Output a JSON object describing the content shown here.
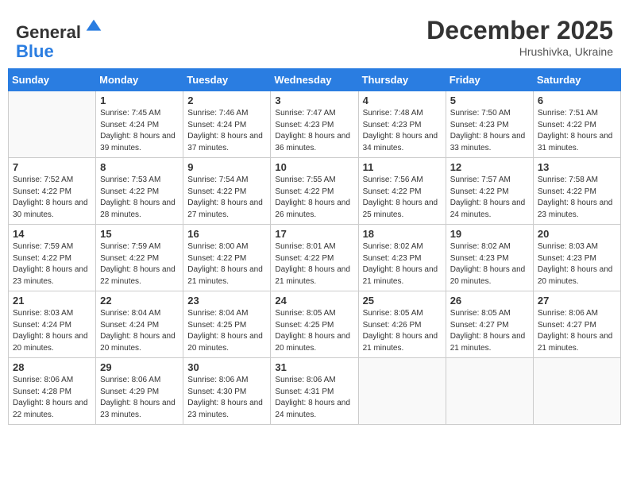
{
  "header": {
    "logo_line1": "General",
    "logo_line2": "Blue",
    "month": "December 2025",
    "location": "Hrushivka, Ukraine"
  },
  "weekdays": [
    "Sunday",
    "Monday",
    "Tuesday",
    "Wednesday",
    "Thursday",
    "Friday",
    "Saturday"
  ],
  "weeks": [
    [
      {
        "day": "",
        "sunrise": "",
        "sunset": "",
        "daylight": ""
      },
      {
        "day": "1",
        "sunrise": "Sunrise: 7:45 AM",
        "sunset": "Sunset: 4:24 PM",
        "daylight": "Daylight: 8 hours and 39 minutes."
      },
      {
        "day": "2",
        "sunrise": "Sunrise: 7:46 AM",
        "sunset": "Sunset: 4:24 PM",
        "daylight": "Daylight: 8 hours and 37 minutes."
      },
      {
        "day": "3",
        "sunrise": "Sunrise: 7:47 AM",
        "sunset": "Sunset: 4:23 PM",
        "daylight": "Daylight: 8 hours and 36 minutes."
      },
      {
        "day": "4",
        "sunrise": "Sunrise: 7:48 AM",
        "sunset": "Sunset: 4:23 PM",
        "daylight": "Daylight: 8 hours and 34 minutes."
      },
      {
        "day": "5",
        "sunrise": "Sunrise: 7:50 AM",
        "sunset": "Sunset: 4:23 PM",
        "daylight": "Daylight: 8 hours and 33 minutes."
      },
      {
        "day": "6",
        "sunrise": "Sunrise: 7:51 AM",
        "sunset": "Sunset: 4:22 PM",
        "daylight": "Daylight: 8 hours and 31 minutes."
      }
    ],
    [
      {
        "day": "7",
        "sunrise": "Sunrise: 7:52 AM",
        "sunset": "Sunset: 4:22 PM",
        "daylight": "Daylight: 8 hours and 30 minutes."
      },
      {
        "day": "8",
        "sunrise": "Sunrise: 7:53 AM",
        "sunset": "Sunset: 4:22 PM",
        "daylight": "Daylight: 8 hours and 28 minutes."
      },
      {
        "day": "9",
        "sunrise": "Sunrise: 7:54 AM",
        "sunset": "Sunset: 4:22 PM",
        "daylight": "Daylight: 8 hours and 27 minutes."
      },
      {
        "day": "10",
        "sunrise": "Sunrise: 7:55 AM",
        "sunset": "Sunset: 4:22 PM",
        "daylight": "Daylight: 8 hours and 26 minutes."
      },
      {
        "day": "11",
        "sunrise": "Sunrise: 7:56 AM",
        "sunset": "Sunset: 4:22 PM",
        "daylight": "Daylight: 8 hours and 25 minutes."
      },
      {
        "day": "12",
        "sunrise": "Sunrise: 7:57 AM",
        "sunset": "Sunset: 4:22 PM",
        "daylight": "Daylight: 8 hours and 24 minutes."
      },
      {
        "day": "13",
        "sunrise": "Sunrise: 7:58 AM",
        "sunset": "Sunset: 4:22 PM",
        "daylight": "Daylight: 8 hours and 23 minutes."
      }
    ],
    [
      {
        "day": "14",
        "sunrise": "Sunrise: 7:59 AM",
        "sunset": "Sunset: 4:22 PM",
        "daylight": "Daylight: 8 hours and 23 minutes."
      },
      {
        "day": "15",
        "sunrise": "Sunrise: 7:59 AM",
        "sunset": "Sunset: 4:22 PM",
        "daylight": "Daylight: 8 hours and 22 minutes."
      },
      {
        "day": "16",
        "sunrise": "Sunrise: 8:00 AM",
        "sunset": "Sunset: 4:22 PM",
        "daylight": "Daylight: 8 hours and 21 minutes."
      },
      {
        "day": "17",
        "sunrise": "Sunrise: 8:01 AM",
        "sunset": "Sunset: 4:22 PM",
        "daylight": "Daylight: 8 hours and 21 minutes."
      },
      {
        "day": "18",
        "sunrise": "Sunrise: 8:02 AM",
        "sunset": "Sunset: 4:23 PM",
        "daylight": "Daylight: 8 hours and 21 minutes."
      },
      {
        "day": "19",
        "sunrise": "Sunrise: 8:02 AM",
        "sunset": "Sunset: 4:23 PM",
        "daylight": "Daylight: 8 hours and 20 minutes."
      },
      {
        "day": "20",
        "sunrise": "Sunrise: 8:03 AM",
        "sunset": "Sunset: 4:23 PM",
        "daylight": "Daylight: 8 hours and 20 minutes."
      }
    ],
    [
      {
        "day": "21",
        "sunrise": "Sunrise: 8:03 AM",
        "sunset": "Sunset: 4:24 PM",
        "daylight": "Daylight: 8 hours and 20 minutes."
      },
      {
        "day": "22",
        "sunrise": "Sunrise: 8:04 AM",
        "sunset": "Sunset: 4:24 PM",
        "daylight": "Daylight: 8 hours and 20 minutes."
      },
      {
        "day": "23",
        "sunrise": "Sunrise: 8:04 AM",
        "sunset": "Sunset: 4:25 PM",
        "daylight": "Daylight: 8 hours and 20 minutes."
      },
      {
        "day": "24",
        "sunrise": "Sunrise: 8:05 AM",
        "sunset": "Sunset: 4:25 PM",
        "daylight": "Daylight: 8 hours and 20 minutes."
      },
      {
        "day": "25",
        "sunrise": "Sunrise: 8:05 AM",
        "sunset": "Sunset: 4:26 PM",
        "daylight": "Daylight: 8 hours and 21 minutes."
      },
      {
        "day": "26",
        "sunrise": "Sunrise: 8:05 AM",
        "sunset": "Sunset: 4:27 PM",
        "daylight": "Daylight: 8 hours and 21 minutes."
      },
      {
        "day": "27",
        "sunrise": "Sunrise: 8:06 AM",
        "sunset": "Sunset: 4:27 PM",
        "daylight": "Daylight: 8 hours and 21 minutes."
      }
    ],
    [
      {
        "day": "28",
        "sunrise": "Sunrise: 8:06 AM",
        "sunset": "Sunset: 4:28 PM",
        "daylight": "Daylight: 8 hours and 22 minutes."
      },
      {
        "day": "29",
        "sunrise": "Sunrise: 8:06 AM",
        "sunset": "Sunset: 4:29 PM",
        "daylight": "Daylight: 8 hours and 23 minutes."
      },
      {
        "day": "30",
        "sunrise": "Sunrise: 8:06 AM",
        "sunset": "Sunset: 4:30 PM",
        "daylight": "Daylight: 8 hours and 23 minutes."
      },
      {
        "day": "31",
        "sunrise": "Sunrise: 8:06 AM",
        "sunset": "Sunset: 4:31 PM",
        "daylight": "Daylight: 8 hours and 24 minutes."
      },
      {
        "day": "",
        "sunrise": "",
        "sunset": "",
        "daylight": ""
      },
      {
        "day": "",
        "sunrise": "",
        "sunset": "",
        "daylight": ""
      },
      {
        "day": "",
        "sunrise": "",
        "sunset": "",
        "daylight": ""
      }
    ]
  ]
}
